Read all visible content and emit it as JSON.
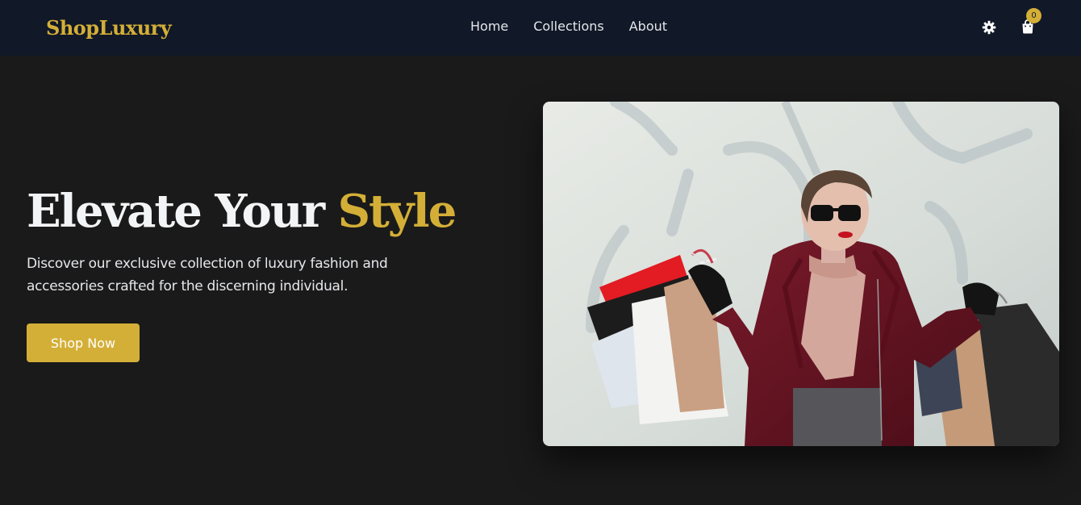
{
  "navbar": {
    "logo": "ShopLuxury",
    "links": [
      "Home",
      "Collections",
      "About"
    ],
    "settings_icon": "gear-icon",
    "cart_icon": "shopping-bag-icon",
    "cart_count": "0"
  },
  "hero": {
    "title_main": "Elevate Your ",
    "title_accent": "Style",
    "description": "Discover our exclusive collection of luxury fashion and accessories crafted for the discerning individual.",
    "cta_label": "Shop Now",
    "image_subject": "woman-with-shopping-bags-photo"
  },
  "colors": {
    "nav_background": "#111827",
    "page_background": "#1a1a1a",
    "accent_gold": "#d4af37",
    "text_light": "#e5e7eb"
  }
}
